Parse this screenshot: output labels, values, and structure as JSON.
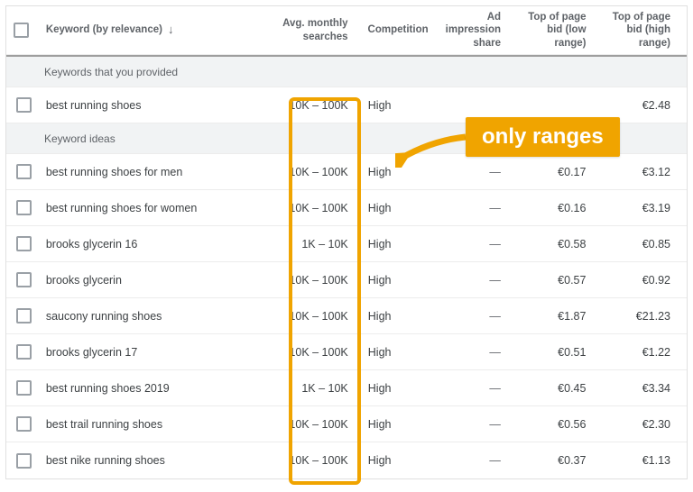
{
  "columns": {
    "keyword": "Keyword (by relevance)",
    "avg": "Avg. monthly searches",
    "competition": "Competition",
    "impression": "Ad impression share",
    "bid_low": "Top of page bid (low range)",
    "bid_high": "Top of page bid (high range)"
  },
  "sections": {
    "provided": {
      "label": "Keywords that you provided"
    },
    "ideas": {
      "label": "Keyword ideas"
    }
  },
  "rows": {
    "provided": [
      {
        "kw": "best running shoes",
        "avg": "10K – 100K",
        "comp": "High",
        "imp": "",
        "low": "",
        "high": "€2.48"
      }
    ],
    "ideas": [
      {
        "kw": "best running shoes for men",
        "avg": "10K – 100K",
        "comp": "High",
        "imp": "—",
        "low": "€0.17",
        "high": "€3.12"
      },
      {
        "kw": "best running shoes for women",
        "avg": "10K – 100K",
        "comp": "High",
        "imp": "—",
        "low": "€0.16",
        "high": "€3.19"
      },
      {
        "kw": "brooks glycerin 16",
        "avg": "1K – 10K",
        "comp": "High",
        "imp": "—",
        "low": "€0.58",
        "high": "€0.85"
      },
      {
        "kw": "brooks glycerin",
        "avg": "10K – 100K",
        "comp": "High",
        "imp": "—",
        "low": "€0.57",
        "high": "€0.92"
      },
      {
        "kw": "saucony running shoes",
        "avg": "10K – 100K",
        "comp": "High",
        "imp": "—",
        "low": "€1.87",
        "high": "€21.23"
      },
      {
        "kw": "brooks glycerin 17",
        "avg": "10K – 100K",
        "comp": "High",
        "imp": "—",
        "low": "€0.51",
        "high": "€1.22"
      },
      {
        "kw": "best running shoes 2019",
        "avg": "1K – 10K",
        "comp": "High",
        "imp": "—",
        "low": "€0.45",
        "high": "€3.34"
      },
      {
        "kw": "best trail running shoes",
        "avg": "10K – 100K",
        "comp": "High",
        "imp": "—",
        "low": "€0.56",
        "high": "€2.30"
      },
      {
        "kw": "best nike running shoes",
        "avg": "10K – 100K",
        "comp": "High",
        "imp": "—",
        "low": "€0.37",
        "high": "€1.13"
      }
    ]
  },
  "callout": {
    "text": "only ranges"
  }
}
